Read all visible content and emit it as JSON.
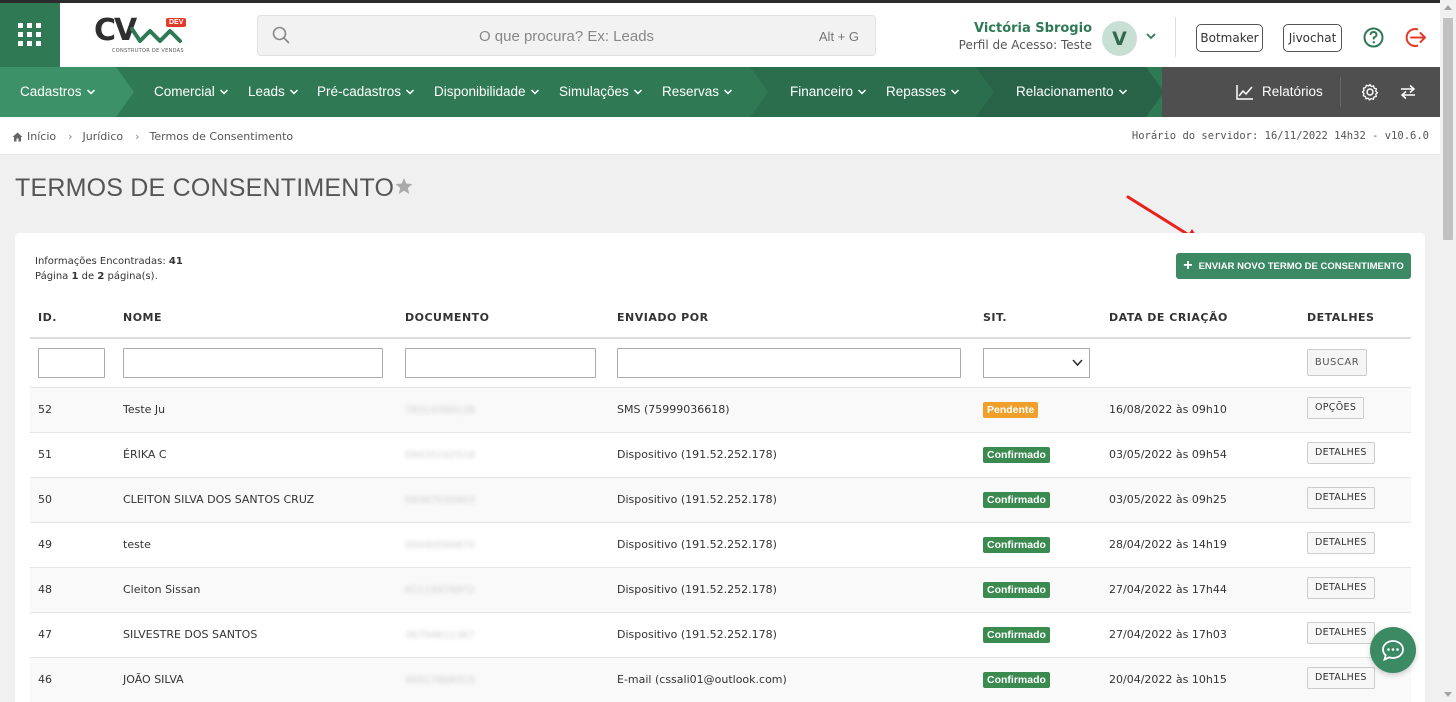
{
  "header": {
    "logo_text": "CV",
    "logo_badge": "DEV",
    "logo_sub": "CONSTRUTOR DE VENDAS",
    "search_placeholder": "O que procura? Ex: Leads",
    "search_shortcut": "Alt + G",
    "user_name": "Victória Sbrogio",
    "user_role": "Perfil de Acesso: Teste",
    "avatar_letter": "V",
    "botmaker_label": "Botmaker",
    "jivochat_label": "Jivochat"
  },
  "nav": {
    "items": [
      {
        "label": "Cadastros"
      },
      {
        "label": "Comercial"
      },
      {
        "label": "Leads"
      },
      {
        "label": "Pré-cadastros"
      },
      {
        "label": "Disponibilidade"
      },
      {
        "label": "Simulações"
      },
      {
        "label": "Reservas"
      },
      {
        "label": "Financeiro"
      },
      {
        "label": "Repasses"
      },
      {
        "label": "Relacionamento"
      }
    ],
    "reports_label": "Relatórios"
  },
  "breadcrumb": {
    "items": [
      "Início",
      "Jurídico",
      "Termos de Consentimento"
    ],
    "server_time": "Horário do servidor: 16/11/2022 14h32 - v10.6.0"
  },
  "page": {
    "title": "TERMOS DE CONSENTIMENTO",
    "info_found_label": "Informações Encontradas:",
    "info_found_count": "41",
    "page_word": "Página",
    "page_current": "1",
    "page_of": "de",
    "page_total": "2",
    "page_suffix": "página(s).",
    "new_button_label": "ENVIAR NOVO TERMO DE CONSENTIMENTO"
  },
  "table": {
    "columns": [
      "ID.",
      "NOME",
      "DOCUMENTO",
      "ENVIADO POR",
      "SIT.",
      "DATA DE CRIAÇÃO",
      "DETALHES"
    ],
    "search_button_label": "BUSCAR",
    "rows": [
      {
        "id": "52",
        "nome": "Teste Ju",
        "documento": "78314389128",
        "enviado_por": "SMS (75999036618)",
        "situacao": "Pendente",
        "data": "16/08/2022 às 09h10",
        "acao": "OPÇÕES"
      },
      {
        "id": "51",
        "nome": "ÉRIKA C",
        "documento": "09435162518",
        "enviado_por": "Dispositivo (191.52.252.178)",
        "situacao": "Confirmado",
        "data": "03/05/2022 às 09h54",
        "acao": "DETALHES"
      },
      {
        "id": "50",
        "nome": "CLEITON SILVA DOS SANTOS CRUZ",
        "documento": "09367030903",
        "enviado_por": "Dispositivo (191.52.252.178)",
        "situacao": "Confirmado",
        "data": "03/05/2022 às 09h25",
        "acao": "DETALHES"
      },
      {
        "id": "49",
        "nome": "teste",
        "documento": "00440566870",
        "enviado_por": "Dispositivo (191.52.252.178)",
        "situacao": "Confirmado",
        "data": "28/04/2022 às 14h19",
        "acao": "DETALHES"
      },
      {
        "id": "48",
        "nome": "Cleiton Sissan",
        "documento": "81119476872",
        "enviado_por": "Dispositivo (191.52.252.178)",
        "situacao": "Confirmado",
        "data": "27/04/2022 às 17h44",
        "acao": "DETALHES"
      },
      {
        "id": "47",
        "nome": "SILVESTRE DOS SANTOS",
        "documento": "36794611367",
        "enviado_por": "Dispositivo (191.52.252.178)",
        "situacao": "Confirmado",
        "data": "27/04/2022 às 17h03",
        "acao": "DETALHES"
      },
      {
        "id": "46",
        "nome": "JOÃO SILVA",
        "documento": "46917868315",
        "enviado_por": "E-mail (cssali01@outlook.com)",
        "situacao": "Confirmado",
        "data": "20/04/2022 às 10h15",
        "acao": "DETALHES"
      }
    ]
  },
  "colors": {
    "primary_green": "#2f7a55",
    "pending_orange": "#f0a02a",
    "confirmed_green": "#3b8a50",
    "annotation_red": "#e8211a"
  }
}
